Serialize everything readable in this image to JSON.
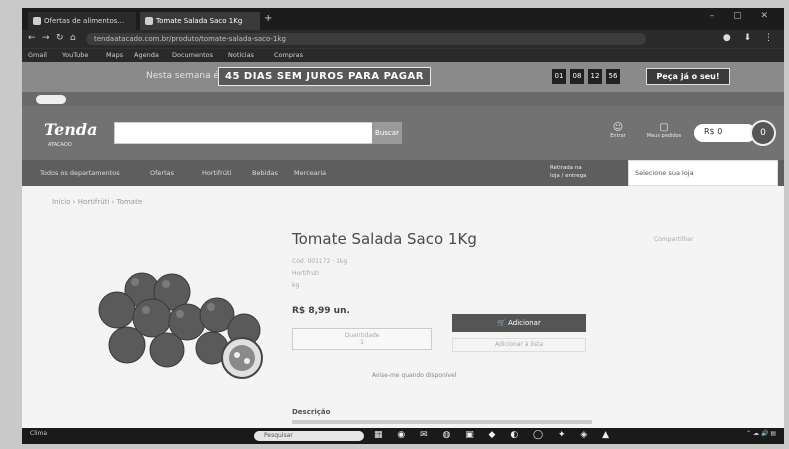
{
  "browser": {
    "tabs": [
      {
        "label": "Ofertas de alimentos..."
      },
      {
        "label": "Tomate Salada Saco 1Kg"
      }
    ],
    "new_tab": "+",
    "window_controls": "– ▢ ✕",
    "nav": {
      "back": "←",
      "forward": "→",
      "reload": "↻",
      "home": "⌂"
    },
    "url": "tendaatacado.com.br/produto/tomate-salada-saco-1kg",
    "extensions": "● ⬇ ⋮",
    "bookmarks": [
      "Gmail",
      "YouTube",
      "Maps",
      "Agenda",
      "Documentos",
      "Notícias",
      "Compras"
    ]
  },
  "promo": {
    "prefix": "Nesta semana é",
    "headline": "45 DIAS SEM JUROS PARA PAGAR",
    "boxes": [
      "01",
      "08",
      "12",
      "56"
    ],
    "cta": "Peça já o seu!"
  },
  "store": {
    "logo": "Tenda",
    "logo_sub": "ATACADO",
    "search_placeholder": "",
    "search_button": "Buscar",
    "account_label": "Entrar",
    "orders_label": "Meus pedidos",
    "cart_total": "R$ 0",
    "cart_count": "0"
  },
  "categories": [
    "Todos os departamentos",
    "Ofertas",
    "Hortifrúti",
    "Bebidas",
    "Mercearia"
  ],
  "delivery_info": [
    "Retirada na",
    "loja / entrega"
  ],
  "store_selector": "Selecione sua loja",
  "breadcrumb": "Início › Hortifrúti › Tomate",
  "product": {
    "title": "Tomate Salada Saco 1Kg",
    "share": "Compartilhar",
    "code": "Cód. 001172 · 1kg",
    "brand": "Hortifruti",
    "unit": "kg",
    "price": "R$ 8,99 un.",
    "quantity_label": "Quantidade",
    "quantity_value": "1",
    "add_button": "Adicionar",
    "list_button": "Adicionar à lista",
    "notify_text": "Avise-me quando disponível",
    "description_heading": "Descrição"
  },
  "taskbar": {
    "search_placeholder": "Pesquisar",
    "icons": "▦ ◉ ✉ ◍ ▣ ◆ ◐ ◯ ✦ ◈ ▲",
    "tray": "⌃ ☁ 🔊 ▤",
    "left_label": "Clima"
  },
  "colors": {
    "accent": "#555555",
    "header": "#727272",
    "banner": "#8a8a8a"
  }
}
